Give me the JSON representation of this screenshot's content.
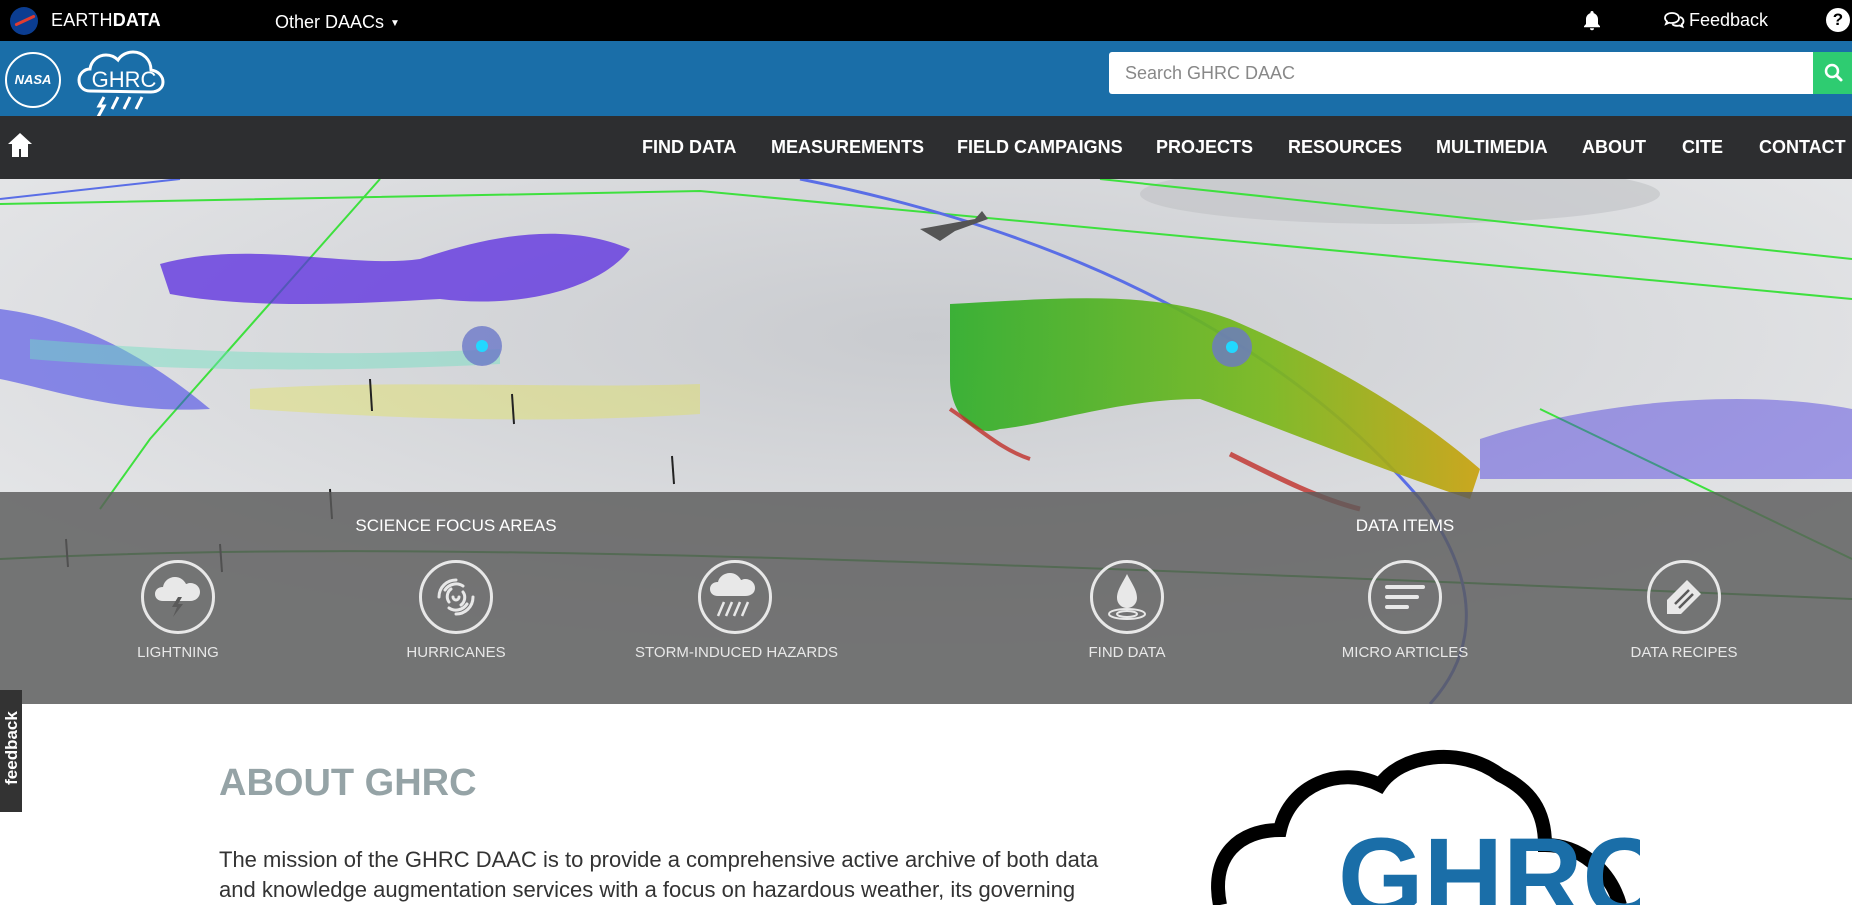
{
  "earthdata": {
    "brand_light": "EARTH",
    "brand_bold": "DATA",
    "daacs_label": "Other DAACs",
    "feedback_label": "Feedback",
    "help_glyph": "?"
  },
  "header": {
    "nasa_text": "NASA",
    "ghrc_logo_text": "GHRC",
    "search_placeholder": "Search GHRC DAAC"
  },
  "nav": {
    "items": [
      "FIND DATA",
      "MEASUREMENTS",
      "FIELD CAMPAIGNS",
      "PROJECTS",
      "RESOURCES",
      "MULTIMEDIA",
      "ABOUT",
      "CITE",
      "CONTACT"
    ]
  },
  "hero": {
    "science_title": "SCIENCE FOCUS AREAS",
    "data_title": "DATA ITEMS",
    "tiles": [
      {
        "label": "LIGHTNING",
        "icon": "lightning-cloud-icon"
      },
      {
        "label": "HURRICANES",
        "icon": "hurricane-icon"
      },
      {
        "label": "STORM-INDUCED HAZARDS",
        "icon": "storm-rain-icon"
      },
      {
        "label": "FIND DATA",
        "icon": "water-drop-icon"
      },
      {
        "label": "MICRO ARTICLES",
        "icon": "article-lines-icon"
      },
      {
        "label": "DATA RECIPES",
        "icon": "pencil-tag-icon"
      }
    ]
  },
  "side_feedback": "feedback",
  "about": {
    "title": "ABOUT GHRC",
    "text": "The mission of the GHRC DAAC is to provide a comprehensive active archive of both data and knowledge augmentation services with a focus on hazardous weather, its governing",
    "logo_text": "GHRC"
  },
  "colors": {
    "header_blue": "#1a6ea8",
    "nav_dark": "#2d2e30",
    "search_green": "#2ecc71",
    "title_gray": "#95a3a6"
  }
}
